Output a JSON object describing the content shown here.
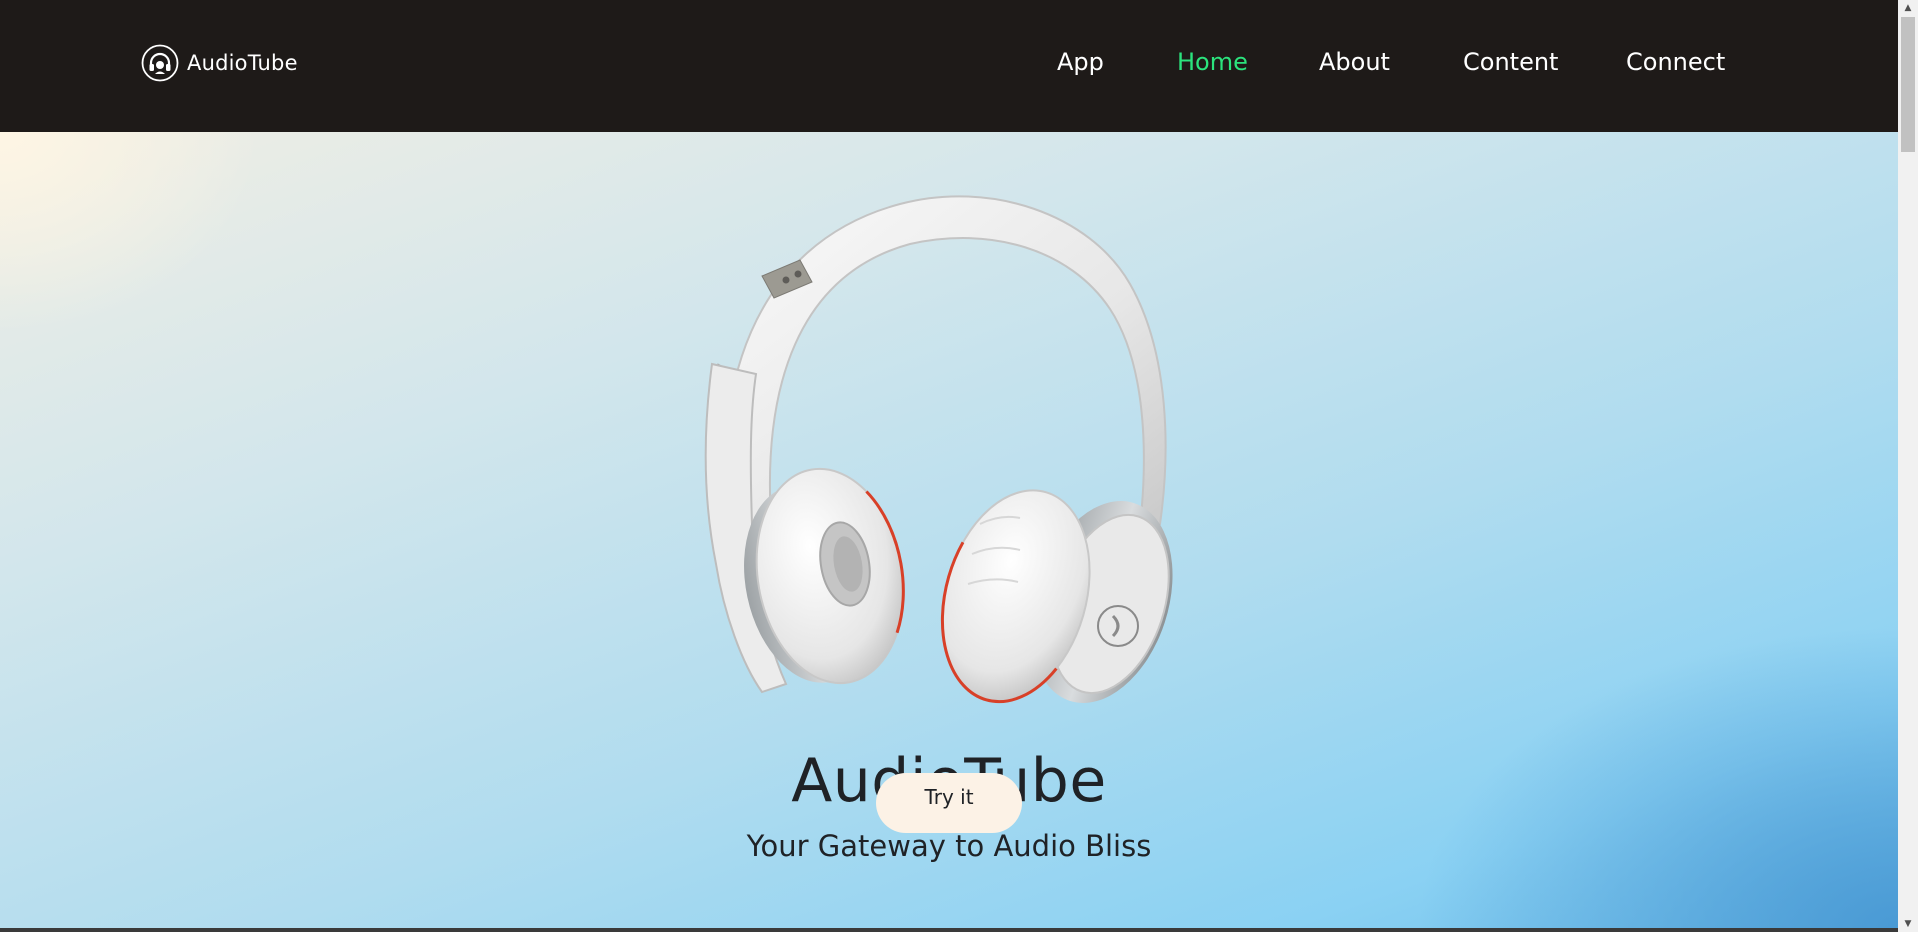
{
  "brand": {
    "name": "AudioTube",
    "icon": "headphones-logo-icon"
  },
  "nav": {
    "items": [
      {
        "label": "App",
        "active": false
      },
      {
        "label": "Home",
        "active": true
      },
      {
        "label": "About",
        "active": false
      },
      {
        "label": "Content",
        "active": false
      },
      {
        "label": "Connect",
        "active": false
      }
    ]
  },
  "hero": {
    "image": "headphones-image",
    "title": "AudioTube",
    "subtitle": "Your Gateway to Audio Bliss",
    "cta_label": "Try it"
  },
  "colors": {
    "nav_background": "#1e1a18",
    "active_link": "#2be37d",
    "text_light": "#ffffff",
    "text_dark": "#1f2226",
    "cta_background": "#fcf2e6"
  }
}
